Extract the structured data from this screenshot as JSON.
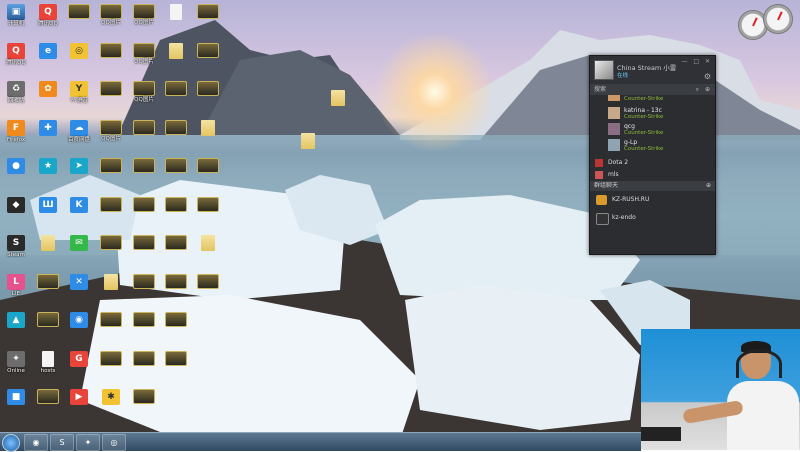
{
  "desktop": {
    "col1": [
      {
        "label": "计算机",
        "icon": "computer-icon",
        "kind": "pc",
        "glyph": "▣"
      },
      {
        "label": "腾讯QQ",
        "icon": "qq-icon",
        "kind": "red",
        "glyph": "Q"
      },
      {
        "label": "回收站",
        "icon": "recycle-bin-icon",
        "kind": "gray",
        "glyph": "♻"
      },
      {
        "label": "Firefox",
        "icon": "firefox-icon",
        "kind": "orange",
        "glyph": "F"
      },
      {
        "label": "",
        "icon": "app-icon",
        "kind": "blue",
        "glyph": "●"
      },
      {
        "label": "",
        "icon": "app-icon",
        "kind": "dark",
        "glyph": "◆"
      },
      {
        "label": "Steam",
        "icon": "steam-icon",
        "kind": "dark",
        "glyph": "S"
      },
      {
        "label": "LIE",
        "icon": "app-icon",
        "kind": "pink",
        "glyph": "L"
      },
      {
        "label": "",
        "icon": "app-icon",
        "kind": "cyan",
        "glyph": "▲"
      },
      {
        "label": "Online",
        "icon": "app-icon",
        "kind": "gray",
        "glyph": "✦"
      },
      {
        "label": "",
        "icon": "app-icon",
        "kind": "blue",
        "glyph": "■"
      }
    ],
    "col2": [
      {
        "label": "腾讯QQ",
        "icon": "qq-icon",
        "kind": "red",
        "glyph": "Q"
      },
      {
        "label": "",
        "icon": "browser-icon",
        "kind": "blue",
        "glyph": "e"
      },
      {
        "label": "",
        "icon": "app-icon",
        "kind": "orange",
        "glyph": "✿"
      },
      {
        "label": "",
        "icon": "app-icon",
        "kind": "blue",
        "glyph": "✚"
      },
      {
        "label": "",
        "icon": "app-icon",
        "kind": "cyan",
        "glyph": "★"
      },
      {
        "label": "",
        "icon": "app-icon",
        "kind": "blue",
        "glyph": "Ш"
      },
      {
        "label": "",
        "icon": "folder-icon",
        "kind": "folder",
        "glyph": ""
      },
      {
        "label": "",
        "icon": "image-icon",
        "kind": "thumb",
        "glyph": ""
      },
      {
        "label": "",
        "icon": "image-icon",
        "kind": "thumb",
        "glyph": ""
      },
      {
        "label": "hosts",
        "icon": "file-icon",
        "kind": "doc",
        "glyph": ""
      },
      {
        "label": "",
        "icon": "image-icon",
        "kind": "thumb",
        "glyph": ""
      }
    ],
    "col3": [
      {
        "label": "",
        "icon": "image-icon",
        "kind": "thumb",
        "glyph": ""
      },
      {
        "label": "",
        "icon": "image-icon",
        "kind": "yellow",
        "glyph": "◎"
      },
      {
        "label": "YY语音",
        "icon": "yy-icon",
        "kind": "yellow",
        "glyph": "Y"
      },
      {
        "label": "百度网盘",
        "icon": "baidu-icon",
        "kind": "blue",
        "glyph": "☁"
      },
      {
        "label": "",
        "icon": "app-icon",
        "kind": "cyan",
        "glyph": "➤"
      },
      {
        "label": "",
        "icon": "app-icon",
        "kind": "blue",
        "glyph": "K"
      },
      {
        "label": "",
        "icon": "wechat-icon",
        "kind": "green",
        "glyph": "✉"
      },
      {
        "label": "",
        "icon": "app-icon",
        "kind": "blue",
        "glyph": "✕"
      },
      {
        "label": "",
        "icon": "app-icon",
        "kind": "blue",
        "glyph": "◉"
      },
      {
        "label": "",
        "icon": "app-icon",
        "kind": "red",
        "glyph": "G"
      },
      {
        "label": "",
        "icon": "app-icon",
        "kind": "red",
        "glyph": "▶"
      }
    ],
    "col4": [
      {
        "label": "QQ图片",
        "icon": "image-icon",
        "kind": "thumb",
        "glyph": ""
      },
      {
        "label": "",
        "icon": "image-icon",
        "kind": "thumb",
        "glyph": ""
      },
      {
        "label": "",
        "icon": "image-icon",
        "kind": "thumb",
        "glyph": ""
      },
      {
        "label": "QQ图片",
        "icon": "image-icon",
        "kind": "thumb",
        "glyph": ""
      },
      {
        "label": "",
        "icon": "image-icon",
        "kind": "thumb",
        "glyph": ""
      },
      {
        "label": "",
        "icon": "image-icon",
        "kind": "thumb",
        "glyph": ""
      },
      {
        "label": "",
        "icon": "image-icon",
        "kind": "thumb",
        "glyph": ""
      },
      {
        "label": "",
        "icon": "folder-icon",
        "kind": "folder",
        "glyph": ""
      },
      {
        "label": "",
        "icon": "image-icon",
        "kind": "thumb",
        "glyph": ""
      },
      {
        "label": "",
        "icon": "image-icon",
        "kind": "thumb",
        "glyph": ""
      },
      {
        "label": "",
        "icon": "image-icon",
        "kind": "yellow",
        "glyph": "✱"
      }
    ],
    "col5": [
      {
        "label": "QQ图片",
        "icon": "image-icon",
        "kind": "thumb",
        "glyph": ""
      },
      {
        "label": "QQ图片",
        "icon": "image-icon",
        "kind": "thumb",
        "glyph": ""
      },
      {
        "label": "QQ图片",
        "icon": "image-icon",
        "kind": "thumb",
        "glyph": ""
      },
      {
        "label": "",
        "icon": "image-icon",
        "kind": "thumb",
        "glyph": ""
      },
      {
        "label": "",
        "icon": "image-icon",
        "kind": "thumb",
        "glyph": ""
      },
      {
        "label": "",
        "icon": "image-icon",
        "kind": "thumb",
        "glyph": ""
      },
      {
        "label": "",
        "icon": "image-icon",
        "kind": "thumb",
        "glyph": ""
      },
      {
        "label": "",
        "icon": "image-icon",
        "kind": "thumb",
        "glyph": ""
      },
      {
        "label": "",
        "icon": "image-icon",
        "kind": "thumb",
        "glyph": ""
      },
      {
        "label": "",
        "icon": "image-icon",
        "kind": "thumb",
        "glyph": ""
      },
      {
        "label": "",
        "icon": "image-icon",
        "kind": "thumb",
        "glyph": ""
      }
    ],
    "col6": [
      {
        "label": "",
        "icon": "image-icon",
        "kind": "doc",
        "glyph": ""
      },
      {
        "label": "",
        "icon": "folder-icon",
        "kind": "folder",
        "glyph": ""
      },
      {
        "label": "",
        "icon": "image-icon",
        "kind": "thumb",
        "glyph": ""
      },
      {
        "label": "",
        "icon": "image-icon",
        "kind": "thumb",
        "glyph": ""
      },
      {
        "label": "",
        "icon": "image-icon",
        "kind": "thumb",
        "glyph": ""
      },
      {
        "label": "",
        "icon": "image-icon",
        "kind": "thumb",
        "glyph": ""
      },
      {
        "label": "",
        "icon": "image-icon",
        "kind": "thumb",
        "glyph": ""
      },
      {
        "label": "",
        "icon": "image-icon",
        "kind": "thumb",
        "glyph": ""
      },
      {
        "label": "",
        "icon": "image-icon",
        "kind": "thumb",
        "glyph": ""
      },
      {
        "label": "",
        "icon": "image-icon",
        "kind": "thumb",
        "glyph": ""
      }
    ],
    "col7": [
      {
        "label": "",
        "icon": "image-icon",
        "kind": "thumb",
        "glyph": ""
      },
      {
        "label": "",
        "icon": "image-icon",
        "kind": "thumb",
        "glyph": ""
      },
      {
        "label": "",
        "icon": "image-icon",
        "kind": "thumb",
        "glyph": ""
      },
      {
        "label": "",
        "icon": "folder-icon",
        "kind": "folder",
        "glyph": ""
      },
      {
        "label": "",
        "icon": "image-icon",
        "kind": "thumb",
        "glyph": ""
      },
      {
        "label": "",
        "icon": "image-icon",
        "kind": "thumb",
        "glyph": ""
      },
      {
        "label": "",
        "icon": "folder-icon",
        "kind": "folder",
        "glyph": ""
      },
      {
        "label": "",
        "icon": "image-icon",
        "kind": "thumb",
        "glyph": ""
      }
    ],
    "misc": [
      {
        "label": "",
        "icon": "folder-icon",
        "kind": "folder"
      },
      {
        "label": "",
        "icon": "folder-icon",
        "kind": "folder"
      }
    ]
  },
  "steam": {
    "user_name": "China Stream 小雷",
    "user_status": "在线",
    "window_controls": "— □ ✕",
    "search_label": "搜索",
    "friends": [
      {
        "name": "",
        "game": "Counter-Strike"
      },
      {
        "name": "katrina - 13c",
        "game": "Counter-Strike"
      },
      {
        "name": "qcg",
        "game": "Counter-Strike"
      },
      {
        "name": "g-Lp",
        "game": "Counter-Strike"
      }
    ],
    "groups": [
      {
        "label": "Dota 2"
      },
      {
        "label": "mls"
      }
    ],
    "chat_header": "群组聊天",
    "chats": [
      {
        "label": "KZ-RUSH.RU"
      },
      {
        "label": "kz-endo"
      }
    ]
  },
  "taskbar": {
    "buttons": [
      {
        "name": "browser-task",
        "glyph": "◉"
      },
      {
        "name": "steam-task",
        "glyph": "S"
      },
      {
        "name": "cs-task",
        "glyph": "✦"
      },
      {
        "name": "app-task",
        "glyph": "◎"
      }
    ]
  }
}
